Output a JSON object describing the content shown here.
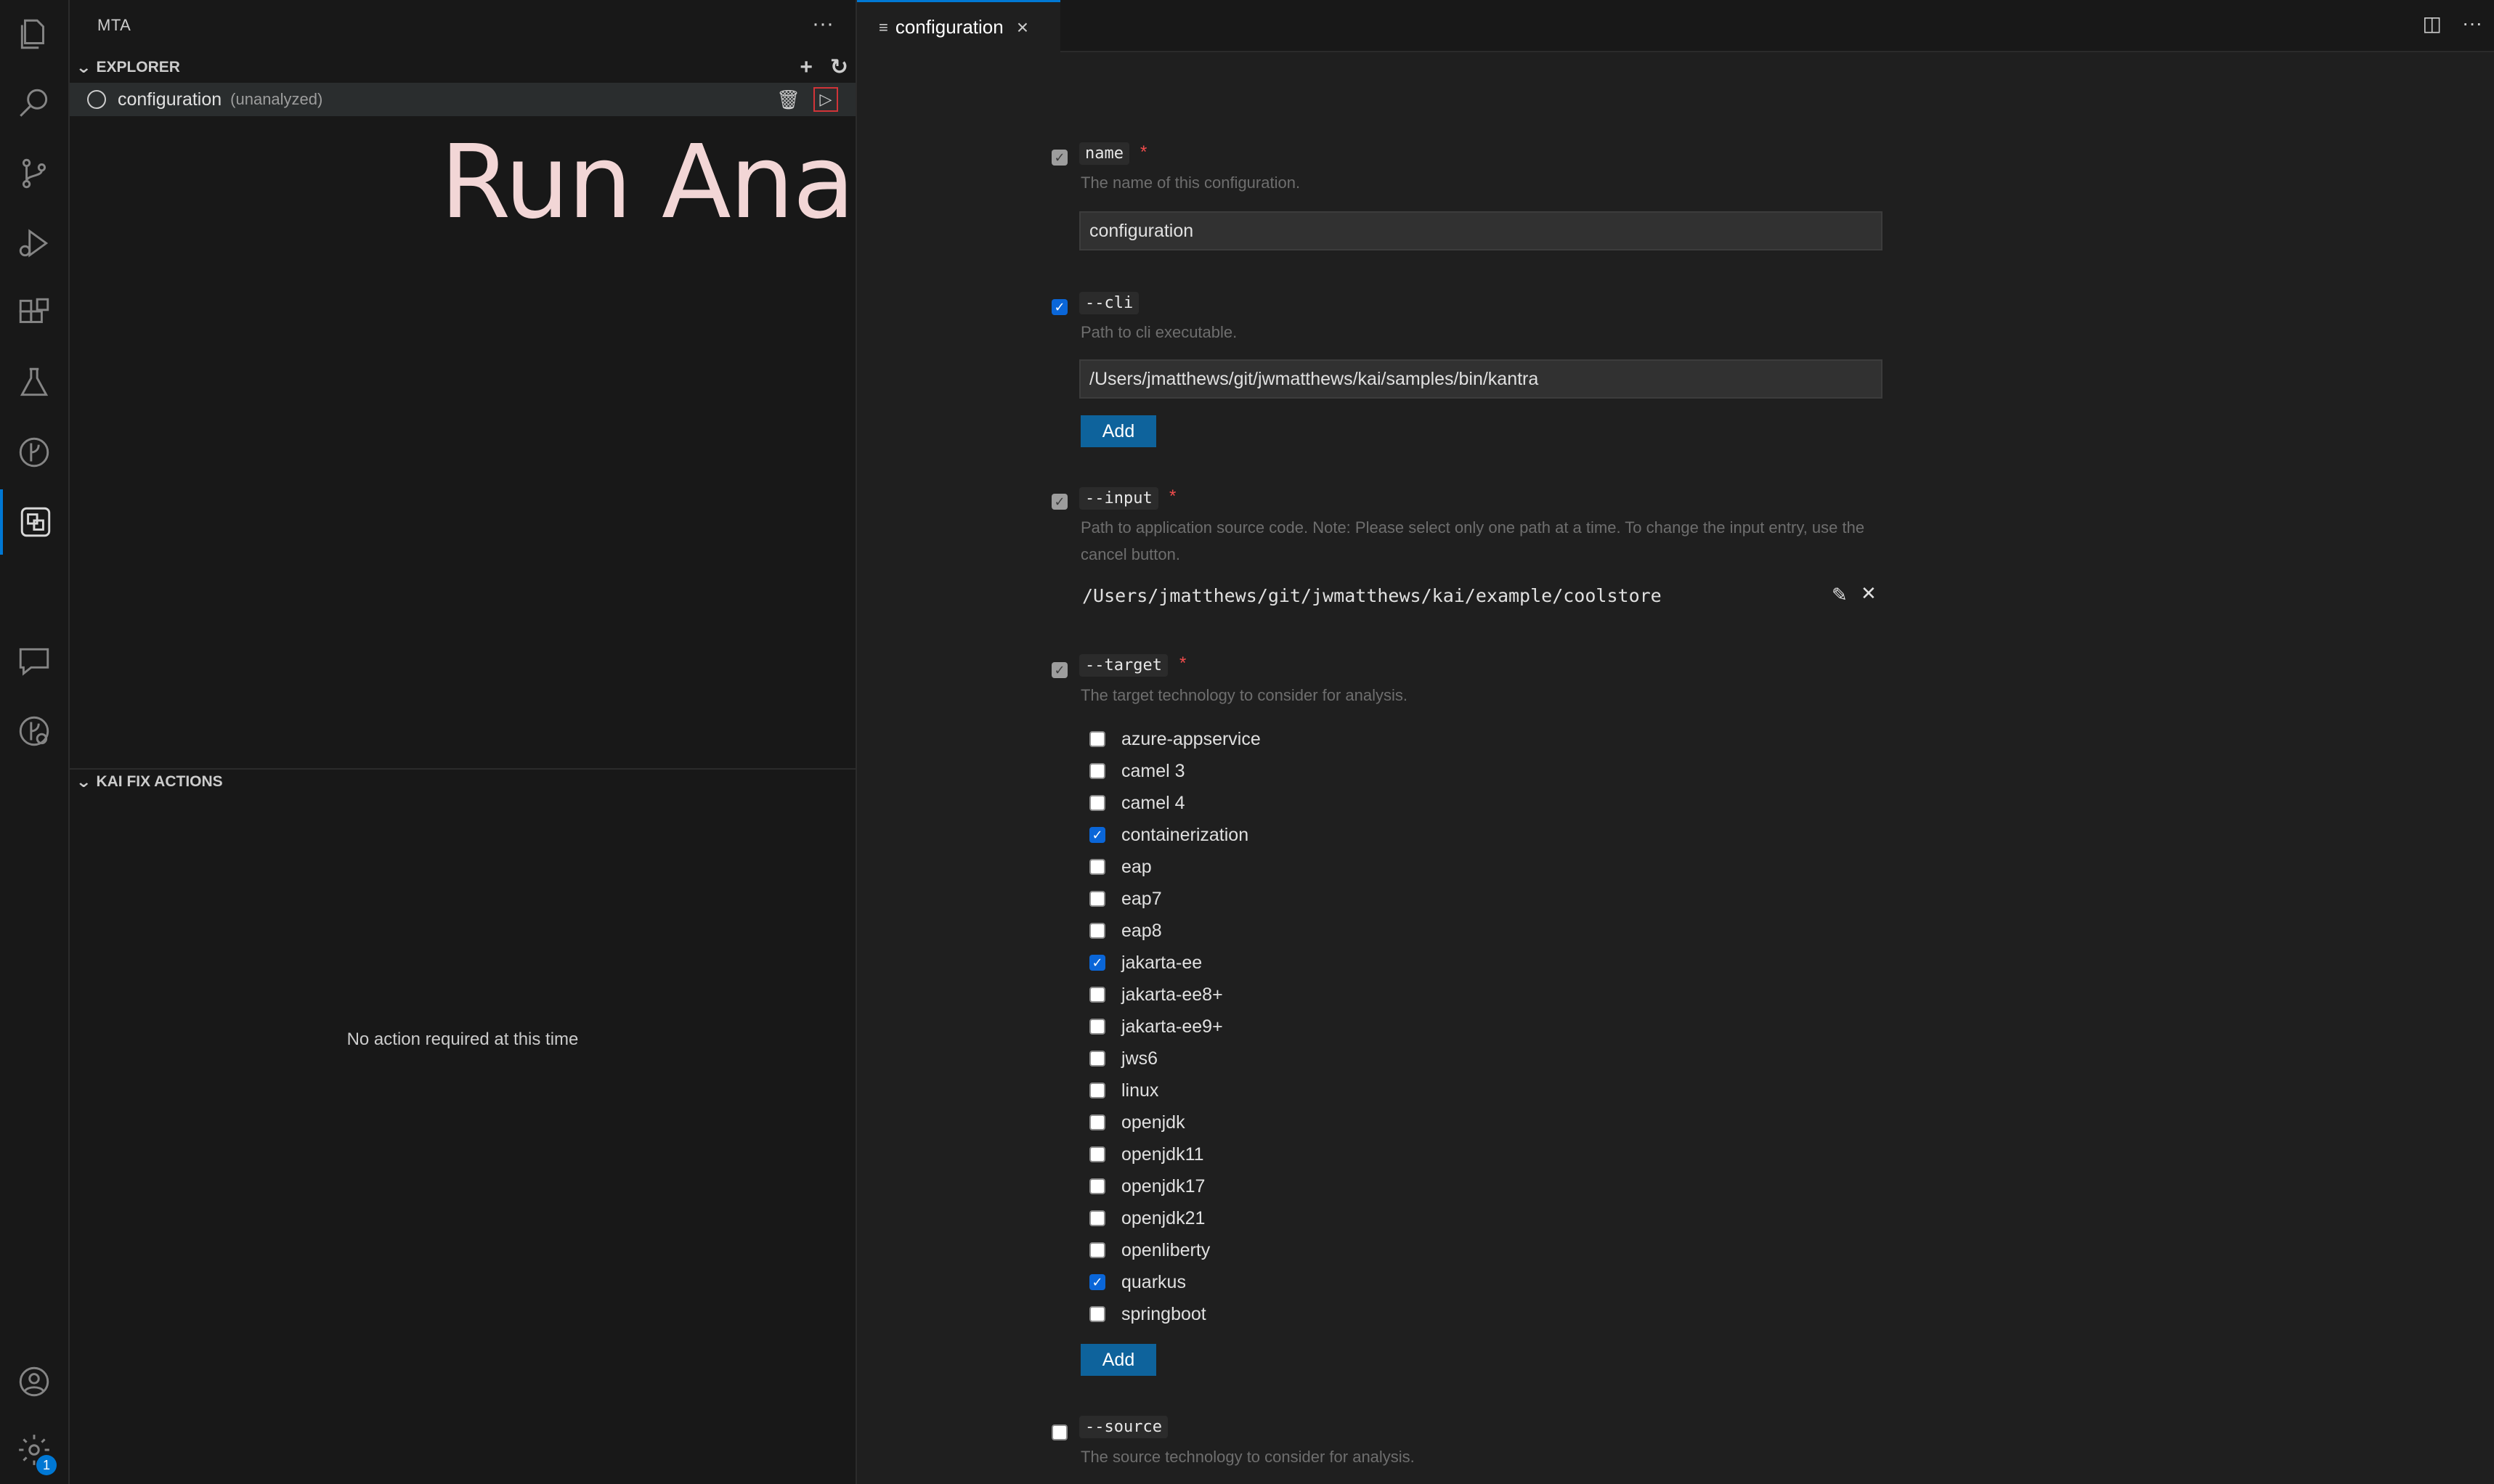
{
  "sidebar": {
    "title": "MTA",
    "more_icon": "ellipsis-icon",
    "explorer": {
      "header": "EXPLORER",
      "item": {
        "name": "configuration",
        "status": "(unanalyzed)"
      }
    },
    "kai": {
      "header": "KAI FIX ACTIONS",
      "empty_message": "No action required at this time"
    },
    "overlay_caption": "Run Analysis"
  },
  "activity_bar": {
    "icons": [
      "explorer-icon",
      "search-icon",
      "source-control-icon",
      "run-debug-icon",
      "extensions-icon",
      "testing-icon",
      "git-graph-icon",
      "mta-icon",
      "chat-icon",
      "kai-icon",
      "account-icon",
      "settings-icon"
    ],
    "settings_badge": "1"
  },
  "editor": {
    "tab_label": "configuration",
    "name_field": {
      "label": "name",
      "required": "*",
      "description": "The name of this configuration.",
      "value": "configuration"
    },
    "cli_field": {
      "label": "--cli",
      "description": "Path to cli executable.",
      "value": "/Users/jmatthews/git/jwmatthews/kai/samples/bin/kantra",
      "add_label": "Add"
    },
    "input_field": {
      "label": "--input",
      "required": "*",
      "description": "Path to application source code. Note: Please select only one path at a time. To change the input entry, use the cancel button.",
      "value": "/Users/jmatthews/git/jwmatthews/kai/example/coolstore"
    },
    "target_field": {
      "label": "--target",
      "required": "*",
      "description": "The target technology to consider for analysis.",
      "options": [
        {
          "label": "azure-appservice",
          "checked": false
        },
        {
          "label": "camel 3",
          "checked": false
        },
        {
          "label": "camel 4",
          "checked": false
        },
        {
          "label": "containerization",
          "checked": true
        },
        {
          "label": "eap",
          "checked": false
        },
        {
          "label": "eap7",
          "checked": false
        },
        {
          "label": "eap8",
          "checked": false
        },
        {
          "label": "jakarta-ee",
          "checked": true
        },
        {
          "label": "jakarta-ee8+",
          "checked": false
        },
        {
          "label": "jakarta-ee9+",
          "checked": false
        },
        {
          "label": "jws6",
          "checked": false
        },
        {
          "label": "linux",
          "checked": false
        },
        {
          "label": "openjdk",
          "checked": false
        },
        {
          "label": "openjdk11",
          "checked": false
        },
        {
          "label": "openjdk17",
          "checked": false
        },
        {
          "label": "openjdk21",
          "checked": false
        },
        {
          "label": "openliberty",
          "checked": false
        },
        {
          "label": "quarkus",
          "checked": true
        },
        {
          "label": "springboot",
          "checked": false
        }
      ],
      "add_label": "Add"
    },
    "source_field": {
      "label": "--source",
      "description": "The source technology to consider for analysis."
    }
  },
  "colors": {
    "accent": "#0078d4",
    "button": "#0e639c",
    "required": "#f14c4c",
    "overlay_text": "#f2d6d6"
  }
}
